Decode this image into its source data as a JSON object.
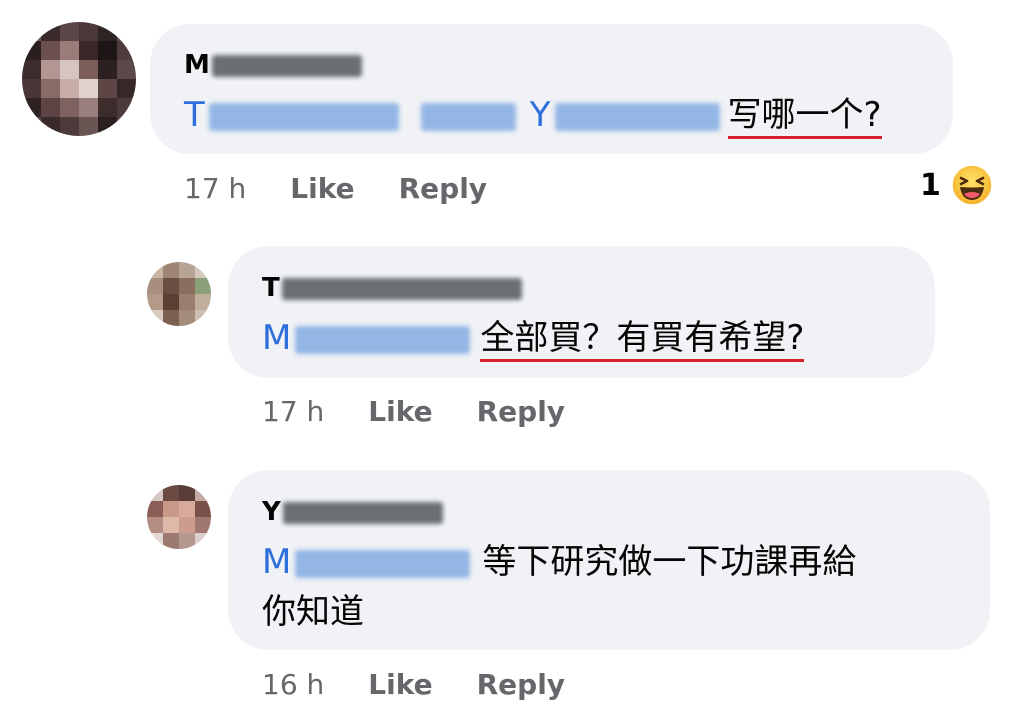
{
  "comments": [
    {
      "author_visible": "M",
      "mention_visible": [
        "T",
        "Y"
      ],
      "text": "写哪一个?",
      "time": "17 h",
      "like": "Like",
      "reply": "Reply",
      "reaction_count": "1",
      "reaction_icon": "laughing-emoji-icon"
    },
    {
      "author_visible": "T",
      "mention_visible": "M",
      "text": "全部買？有買有希望?",
      "time": "17 h",
      "like": "Like",
      "reply": "Reply"
    },
    {
      "author_visible": "Y",
      "mention_visible": "M",
      "text_line1": "等下研究做一下功課再給",
      "text_line2": "你知道",
      "time": "16 h",
      "like": "Like",
      "reply": "Reply"
    }
  ],
  "colors": {
    "bubble": "#f0f2f5",
    "mention": "#2e6fdd",
    "meta": "#65676b",
    "underline": "#d6202a"
  }
}
